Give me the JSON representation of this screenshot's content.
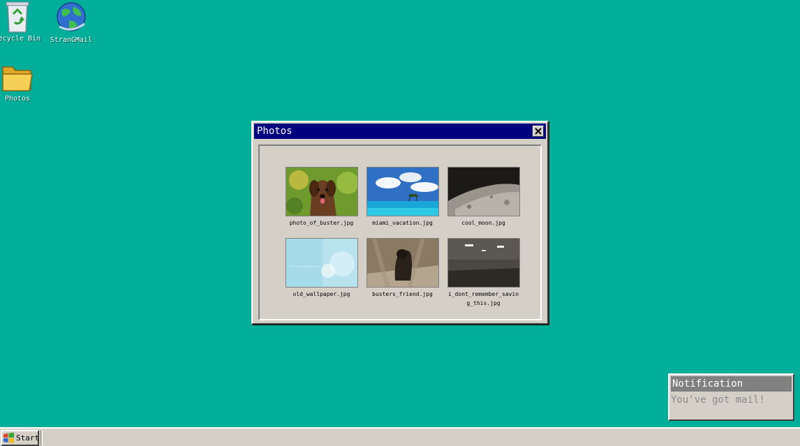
{
  "desktop": {
    "icons": [
      {
        "label": "Recycle Bin",
        "icon": "recycle-bin-icon"
      },
      {
        "label": "StranGMail",
        "icon": "globe-mail-icon"
      },
      {
        "label": "Photos",
        "icon": "folder-icon"
      }
    ]
  },
  "window": {
    "title": "Photos",
    "photos": [
      {
        "name": "photo_of_buster.jpg"
      },
      {
        "name": "miami_vacation.jpg"
      },
      {
        "name": "cool_moon.jpg"
      },
      {
        "name": "old_wallpaper.jpg"
      },
      {
        "name": "busters_friend.jpg"
      },
      {
        "name": "i_dont_remember_saving_this.jpg"
      }
    ]
  },
  "notification": {
    "title": "Notification",
    "message": "You've got mail!"
  },
  "taskbar": {
    "start_label": "Start"
  },
  "colors": {
    "desktop": "#00ae9a",
    "titlebar": "#000080",
    "chrome": "#d4d0c8",
    "notification_title": "#808080"
  }
}
